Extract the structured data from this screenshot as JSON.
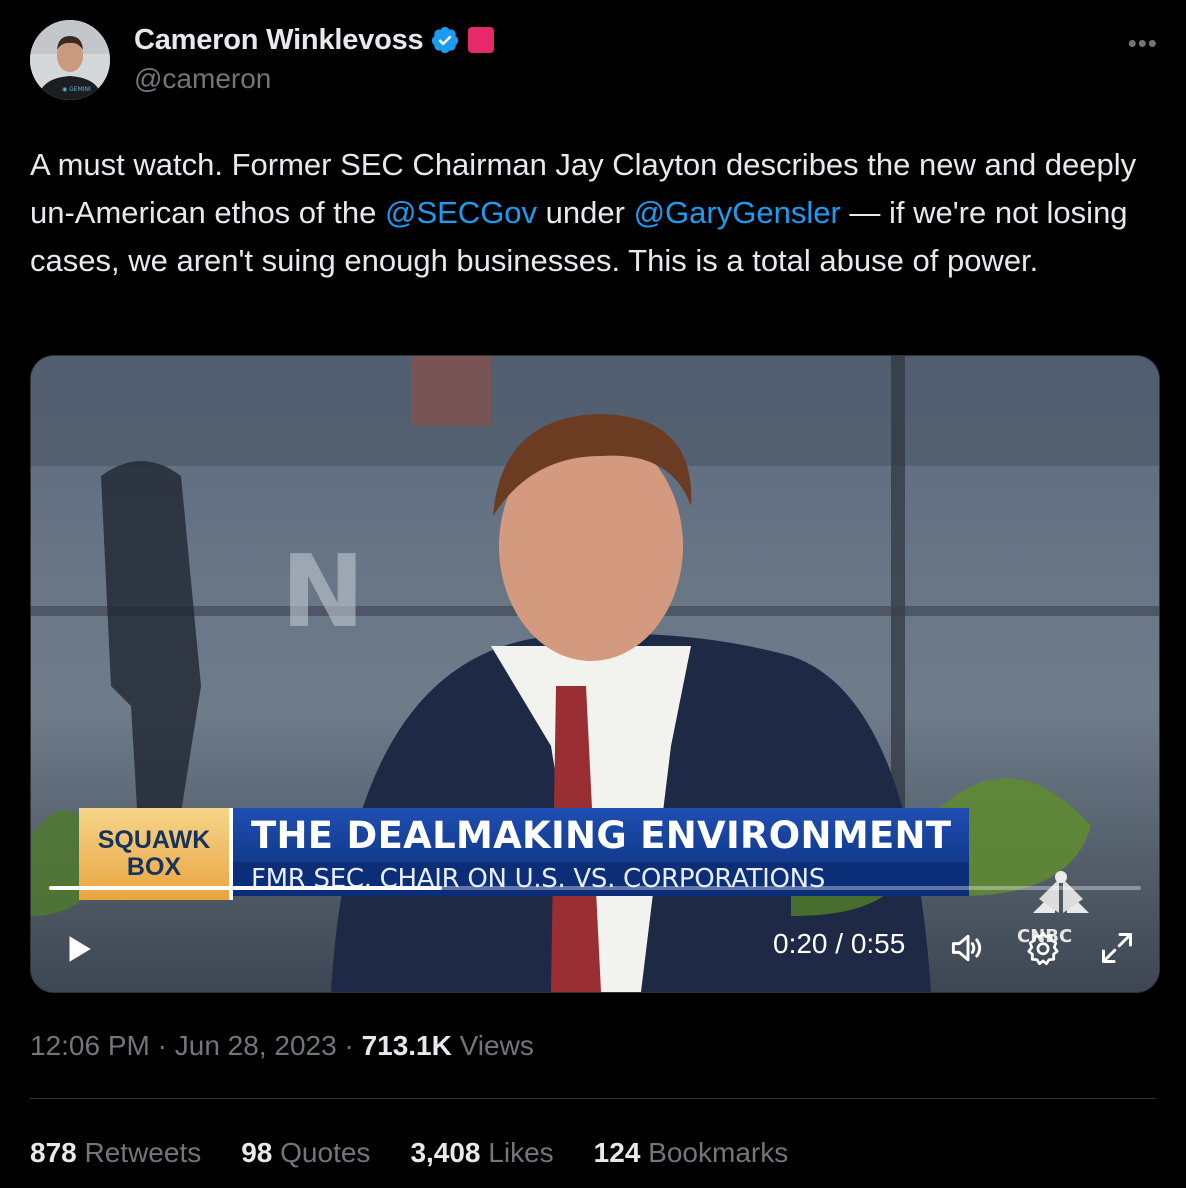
{
  "author": {
    "display_name": "Cameron Winklevoss",
    "handle": "@cameron",
    "verified_color": "#1d9bf0",
    "affiliate_badge_color": "#e6296a"
  },
  "more_icon": "more-horizontal-icon",
  "tweet": {
    "text_parts": {
      "p1": "A must watch. Former SEC Chairman Jay Clayton describes the new and deeply un-American ethos of the ",
      "mention1": "@SECGov",
      "p2": " under ",
      "mention2": "@GaryGensler",
      "p3": " — if we're not losing cases, we aren't suing enough businesses. This is a total abuse of power."
    }
  },
  "video": {
    "lower_third": {
      "show_line1": "SQUAWK",
      "show_line2": "BOX",
      "headline": "THE DEALMAKING ENVIRONMENT",
      "subhead": "FMR SEC. CHAIR ON U.S. VS. CORPORATIONS"
    },
    "network_logo": "CNBC",
    "time": "0:20 / 0:55",
    "progress": 0.36
  },
  "meta": {
    "time": "12:06 PM",
    "date": "Jun 28, 2023",
    "sep": "·",
    "views_count": "713.1K",
    "views_label": "Views"
  },
  "stats": {
    "retweets_count": "878",
    "retweets_label": "Retweets",
    "quotes_count": "98",
    "quotes_label": "Quotes",
    "likes_count": "3,408",
    "likes_label": "Likes",
    "bookmarks_count": "124",
    "bookmarks_label": "Bookmarks"
  },
  "colors": {
    "background": "#000000",
    "text": "#e7e9ea",
    "secondary": "#71767b",
    "link": "#1d9bf0"
  }
}
